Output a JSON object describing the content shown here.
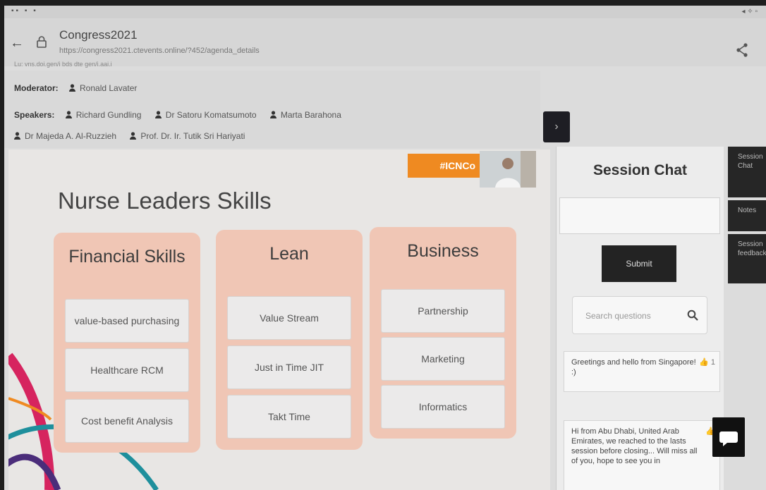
{
  "status_bar": {
    "left": "▪▪ ▪ ▪",
    "right": "◂ ✧ ▫"
  },
  "browser": {
    "site_title": "Congress2021",
    "url": "https://congress2021.ctevents.online/?452/agenda_details",
    "sub_url": "Lu: vns.doi.gen/i bds dte gen/i.aai.i"
  },
  "moderator": {
    "label": "Moderator:",
    "name": "Ronald Lavater"
  },
  "speakers": {
    "label": "Speakers:",
    "row1": [
      "Richard Gundling",
      "Dr Satoru Komatsumoto",
      "Marta Barahona"
    ],
    "row2": [
      "Dr Majeda A. Al-Ruzzieh",
      "Prof. Dr. Ir. Tutik Sri Hariyati"
    ]
  },
  "collapse_button": "›",
  "slide": {
    "hashtag": "#ICNCo",
    "title": "Nurse Leaders Skills",
    "columns": [
      {
        "heading": "Financial Skills",
        "items": [
          "value-based purchasing",
          "Healthcare RCM",
          "Cost benefit Analysis"
        ]
      },
      {
        "heading": "Lean",
        "items": [
          "Value Stream",
          "Just in Time JIT",
          "Takt Time"
        ]
      },
      {
        "heading": "Business",
        "items": [
          "Partnership",
          "Marketing",
          "Informatics"
        ]
      }
    ],
    "colors": {
      "card": "#f0c6b5",
      "hashtag_bg": "#ef8a21",
      "swoosh_pink": "#d6245f",
      "swoosh_teal": "#1e8f9c",
      "swoosh_purple": "#4b2d7a"
    }
  },
  "chat": {
    "title": "Session Chat",
    "input_value": "",
    "submit_label": "Submit",
    "search_placeholder": "Search questions",
    "messages": [
      {
        "text": "Greetings and hello from Singapore! :)",
        "like": "👍 1"
      },
      {
        "text": "Hi from Abu Dhabi, United Arab Emirates, we reached to the lasts session before closing... Will miss all of you, hope to see you in",
        "like": "👍"
      }
    ]
  },
  "side_tabs": [
    "Session Chat",
    "Notes",
    "Session feedback"
  ]
}
